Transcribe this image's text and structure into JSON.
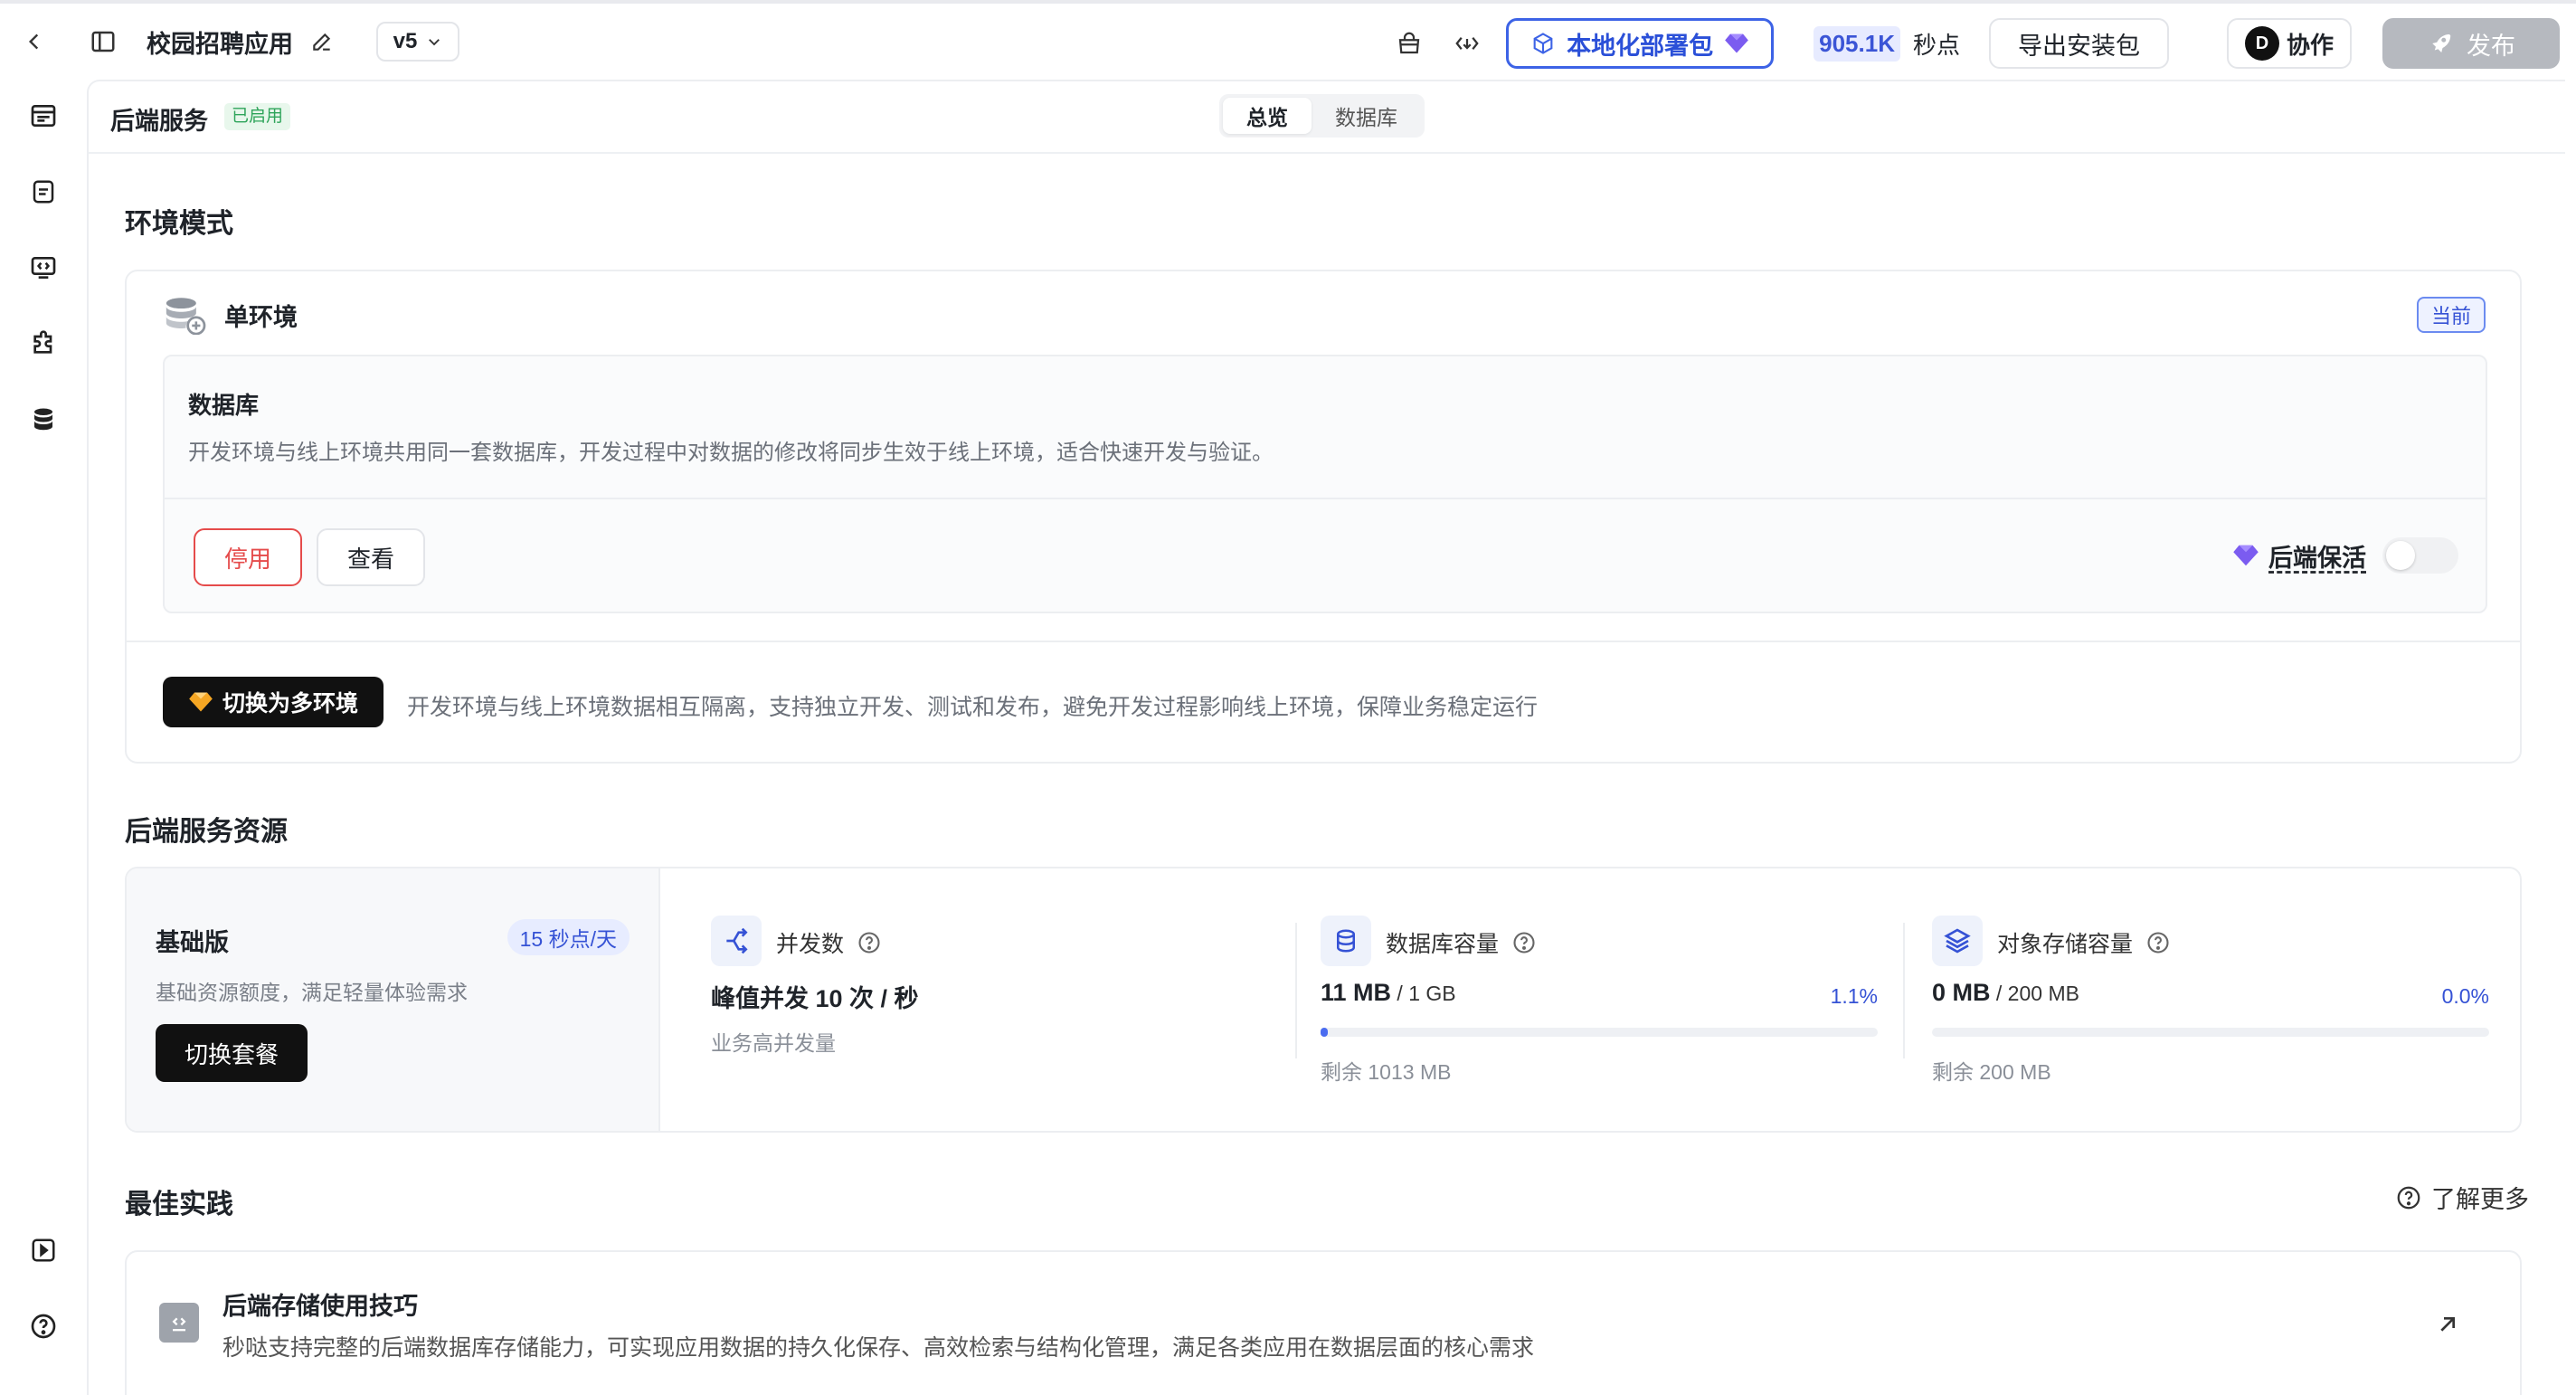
{
  "header": {
    "app_title": "校园招聘应用",
    "version": "v5",
    "deploy_label": "本地化部署包",
    "points_value": "905.1K",
    "points_unit": "秒点",
    "export_label": "导出安装包",
    "avatar_letter": "D",
    "collab_label": "协作",
    "publish_label": "发布"
  },
  "panel": {
    "title": "后端服务",
    "status": "已启用",
    "tabs": [
      {
        "label": "总览",
        "active": true
      },
      {
        "label": "数据库",
        "active": false
      }
    ]
  },
  "env": {
    "section_title": "环境模式",
    "mode_label": "单环境",
    "current_badge": "当前",
    "db_title": "数据库",
    "db_desc": "开发环境与线上环境共用同一套数据库，开发过程中对数据的修改将同步生效于线上环境，适合快速开发与验证。",
    "stop_label": "停用",
    "view_label": "查看",
    "keepalive_label": "后端保活",
    "keepalive_on": false,
    "switch_label": "切换为多环境",
    "switch_desc": "开发环境与线上环境数据相互隔离，支持独立开发、测试和发布，避免开发过程影响线上环境，保障业务稳定运行"
  },
  "resources": {
    "section_title": "后端服务资源",
    "plan": {
      "name": "基础版",
      "price": "15 秒点/天",
      "desc": "基础资源额度，满足轻量体验需求",
      "switch_label": "切换套餐"
    },
    "concurrency": {
      "label": "并发数",
      "value": "峰值并发 10 次 / 秒",
      "note": "业务高并发量"
    },
    "db_capacity": {
      "label": "数据库容量",
      "used": "11 MB",
      "total": " / 1 GB",
      "pct": "1.1%",
      "fraction": 0.011,
      "note": "剩余 1013 MB"
    },
    "object_storage": {
      "label": "对象存储容量",
      "used": "0 MB",
      "total": " / 200 MB",
      "pct": "0.0%",
      "fraction": 0.0,
      "note": "剩余 200 MB"
    }
  },
  "best_practice": {
    "section_title": "最佳实践",
    "learn_more": "了解更多",
    "items": [
      {
        "title": "后端存储使用技巧",
        "desc": "秒哒支持完整的后端数据库存储能力，可实现应用数据的持久化保存、高效检索与结构化管理，满足各类应用在数据层面的核心需求"
      }
    ]
  },
  "colors": {
    "accent": "#3d63e6",
    "danger": "#e54b4b",
    "success": "#2ea45a"
  }
}
